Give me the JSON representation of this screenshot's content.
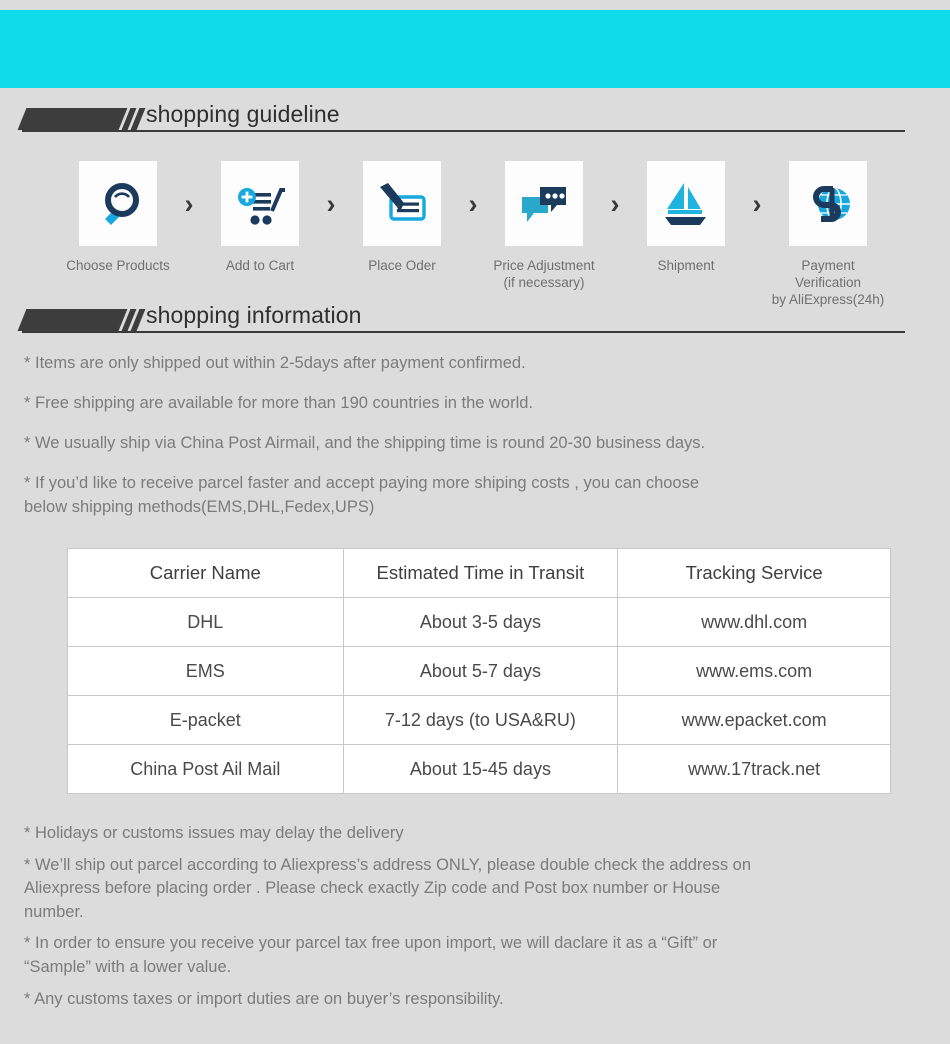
{
  "banner": {
    "color": "#0edceb"
  },
  "background_color": "#dcdcdc",
  "sections": {
    "guideline": {
      "title": "shopping guideline"
    },
    "information": {
      "title": "shopping information"
    }
  },
  "steps": [
    {
      "icon": "magnifier-icon",
      "label": "Choose Products"
    },
    {
      "icon": "add-to-cart-icon",
      "label": "Add to Cart"
    },
    {
      "icon": "pen-form-icon",
      "label": "Place Oder"
    },
    {
      "icon": "chat-bubbles-icon",
      "label": "Price Adjustment\n(if necessary)"
    },
    {
      "icon": "sailboat-icon",
      "label": "Shipment"
    },
    {
      "icon": "dollar-globe-icon",
      "label": "Payment Verification\nby AliExpress(24h)"
    }
  ],
  "step_separator": "›",
  "shipping_info_lines": [
    "* Items are only shipped out within 2-5days after payment confirmed.",
    "* Free shipping are available for more than 190 countries in the world.",
    "* We usually ship via China Post Airmail, and the shipping time is round 20-30 business days.",
    "* If you’d like to receive parcel faster and accept paying more shiping costs , you can choose\n   below shipping methods(EMS,DHL,Fedex,UPS)"
  ],
  "carrier_table": {
    "columns": [
      "Carrier Name",
      "Estimated Time in Transit",
      "Tracking Service"
    ],
    "rows": [
      [
        "DHL",
        "About 3-5 days",
        "www.dhl.com"
      ],
      [
        "EMS",
        "About 5-7 days",
        "www.ems.com"
      ],
      [
        "E-packet",
        "7-12 days (to USA&RU)",
        "www.epacket.com"
      ],
      [
        "China Post Ail Mail",
        "About 15-45 days",
        "www.17track.net"
      ]
    ]
  },
  "notes_lines": [
    "* Holidays or customs issues may delay the delivery",
    "* We’ll ship out parcel according to Aliexpress’s address ONLY, please double check the address on\n   Aliexpress before placing order . Please check exactly Zip code and Post box  number or House\n   number.",
    "* In order to ensure you receive your parcel tax free upon import, we will daclare it as a  “Gift”  or\n   “Sample”  with a lower value.",
    "* Any customs taxes or import duties are on buyer’s responsibility."
  ]
}
